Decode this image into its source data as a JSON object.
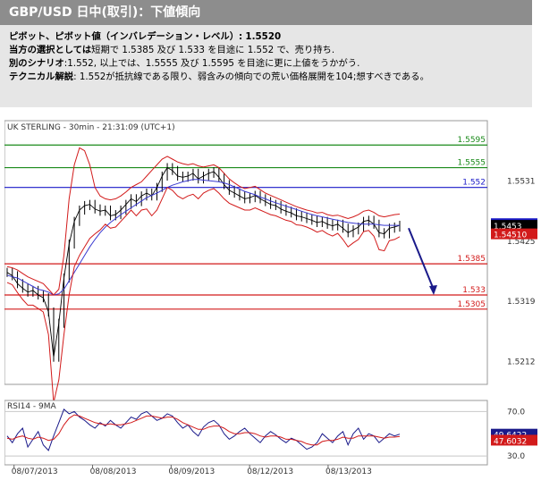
{
  "header": {
    "title": "GBP/USD 日中(取引)：下値傾向"
  },
  "analysis": {
    "pivot_label": "ピボット、ピボット値（インバレデーション・レベル）:",
    "pivot_value": "1.5520",
    "choice_label": "当方の選択としては",
    "choice_text": "短期で 1.5385 及び 1.533 を目途に 1.552 で、売り持ち.",
    "alt_label": "別のシナリオ",
    "alt_text": ":1.552, 以上では、1.5555 及び 1.5595 を目途に更に上値をうかがう.",
    "tech_label": "テクニカル解説",
    "tech_text": ": 1.552が抵抗線である限り、弱含みの傾向での荒い価格展開を104;想すべきである。"
  },
  "chart_data": [
    {
      "type": "line",
      "title": "UK STERLING - 30min - 21:31:09 (UTC+1)",
      "x_tick_labels": [
        "08/07/2013",
        "08/08/2013",
        "08/09/2013",
        "08/12/2013",
        "08/13/2013"
      ],
      "y_tick_labels": [
        "1.5531",
        "1.5425",
        "1.5319",
        "1.5212"
      ],
      "y_ticks": [
        1.5531,
        1.5425,
        1.5319,
        1.5212
      ],
      "ylim": [
        1.5172,
        1.5638
      ],
      "level_lines": [
        {
          "label": "1.5595",
          "value": 1.5595,
          "color": "#1a8a1a"
        },
        {
          "label": "1.5555",
          "value": 1.5555,
          "color": "#1a8a1a"
        },
        {
          "label": "1.552",
          "value": 1.552,
          "color": "#1a1ac8"
        },
        {
          "label": "1.5385",
          "value": 1.5385,
          "color": "#d21a1a"
        },
        {
          "label": "1.533",
          "value": 1.533,
          "color": "#d21a1a"
        },
        {
          "label": "1.5305",
          "value": 1.5305,
          "color": "#d21a1a"
        }
      ],
      "price_tags": [
        {
          "label": "1.54562",
          "value": 1.5456,
          "color": "#1a1ac8",
          "text_color": "#ffffff"
        },
        {
          "label": "1.5453",
          "value": 1.5453,
          "color": "#000000",
          "text_color": "#ffffff"
        },
        {
          "label": "1.54510",
          "value": 1.5438,
          "color": "#d21a1a",
          "text_color": "#ffffff"
        }
      ],
      "arrow": {
        "from": [
          1.5448
        ],
        "to": [
          1.533
        ],
        "color": "#1a1a8a"
      },
      "series": [
        {
          "color": "#000000",
          "values": [
            1.537,
            1.5364,
            1.535,
            1.5342,
            1.5335,
            1.5338,
            1.533,
            1.5325,
            1.53,
            1.522,
            1.528,
            1.536,
            1.542,
            1.546,
            1.548,
            1.5488,
            1.549,
            1.5482,
            1.5478,
            1.548,
            1.547,
            1.5472,
            1.548,
            1.549,
            1.55,
            1.5495,
            1.5505,
            1.551,
            1.5505,
            1.552,
            1.554,
            1.5555,
            1.555,
            1.554,
            1.5538,
            1.554,
            1.5545,
            1.5535,
            1.554,
            1.5545,
            1.5548,
            1.5538,
            1.5525,
            1.5515,
            1.551,
            1.5505,
            1.55,
            1.5502,
            1.5506,
            1.55,
            1.5495,
            1.549,
            1.5488,
            1.5482,
            1.5478,
            1.5475,
            1.547,
            1.5468,
            1.5465,
            1.5462,
            1.5458,
            1.546,
            1.5455,
            1.5452,
            1.5455,
            1.5448,
            1.544,
            1.5445,
            1.545,
            1.546,
            1.5462,
            1.5455,
            1.544,
            1.5438,
            1.5448,
            1.545,
            1.5453
          ]
        },
        {
          "color": "#3a3ad0",
          "values": [
            1.5365,
            1.5362,
            1.536,
            1.5355,
            1.535,
            1.5345,
            1.534,
            1.5338,
            1.5335,
            1.533,
            1.5332,
            1.534,
            1.5355,
            1.537,
            1.5385,
            1.54,
            1.5415,
            1.5428,
            1.544,
            1.545,
            1.5458,
            1.5465,
            1.5472,
            1.5478,
            1.5484,
            1.549,
            1.5496,
            1.5502,
            1.5506,
            1.551,
            1.5515,
            1.552,
            1.5524,
            1.5527,
            1.553,
            1.5532,
            1.5534,
            1.5534,
            1.5533,
            1.5532,
            1.5531,
            1.553,
            1.5528,
            1.5525,
            1.5521,
            1.5517,
            1.5513,
            1.551,
            1.5507,
            1.5503,
            1.55,
            1.5496,
            1.5493,
            1.549,
            1.5487,
            1.5484,
            1.5481,
            1.5478,
            1.5475,
            1.5472,
            1.547,
            1.5468,
            1.5466,
            1.5464,
            1.5462,
            1.546,
            1.5458,
            1.5457,
            1.5456,
            1.5455,
            1.5455,
            1.5455,
            1.5454,
            1.5453,
            1.5453,
            1.5453,
            1.5453
          ]
        },
        {
          "color": "#d21a1a",
          "values": [
            1.538,
            1.5378,
            1.5374,
            1.5368,
            1.5362,
            1.5358,
            1.5354,
            1.535,
            1.534,
            1.533,
            1.534,
            1.54,
            1.55,
            1.556,
            1.559,
            1.5585,
            1.556,
            1.552,
            1.5505,
            1.55,
            1.5498,
            1.55,
            1.5505,
            1.5512,
            1.552,
            1.5525,
            1.553,
            1.554,
            1.555,
            1.556,
            1.557,
            1.5575,
            1.557,
            1.5565,
            1.5562,
            1.556,
            1.5562,
            1.5558,
            1.5556,
            1.5558,
            1.556,
            1.5555,
            1.5545,
            1.5535,
            1.5528,
            1.5522,
            1.5518,
            1.552,
            1.5522,
            1.5516,
            1.551,
            1.5506,
            1.5502,
            1.5498,
            1.5494,
            1.549,
            1.5486,
            1.5483,
            1.548,
            1.5478,
            1.5475,
            1.5476,
            1.5472,
            1.547,
            1.5471,
            1.5468,
            1.5465,
            1.5468,
            1.5472,
            1.5478,
            1.548,
            1.5476,
            1.547,
            1.5468,
            1.547,
            1.5472,
            1.5473
          ]
        },
        {
          "color": "#d21a1a",
          "values": [
            1.5352,
            1.5348,
            1.5334,
            1.5322,
            1.5312,
            1.5312,
            1.5306,
            1.53,
            1.526,
            1.514,
            1.518,
            1.526,
            1.533,
            1.538,
            1.54,
            1.5415,
            1.543,
            1.5438,
            1.5445,
            1.5455,
            1.5448,
            1.545,
            1.546,
            1.547,
            1.548,
            1.547,
            1.548,
            1.5482,
            1.547,
            1.548,
            1.55,
            1.552,
            1.5515,
            1.5505,
            1.55,
            1.5505,
            1.5508,
            1.55,
            1.551,
            1.5515,
            1.5518,
            1.551,
            1.55,
            1.5492,
            1.5488,
            1.5484,
            1.548,
            1.548,
            1.5484,
            1.548,
            1.5476,
            1.5472,
            1.547,
            1.5466,
            1.5462,
            1.546,
            1.5454,
            1.5453,
            1.545,
            1.5446,
            1.5441,
            1.5444,
            1.5438,
            1.5434,
            1.5439,
            1.5428,
            1.5415,
            1.5422,
            1.5428,
            1.5442,
            1.5444,
            1.5434,
            1.541,
            1.5408,
            1.5426,
            1.5428,
            1.5433
          ]
        }
      ]
    },
    {
      "type": "line",
      "title": "RSI14 - 9MA",
      "y_tick_labels": [
        "70.0",
        "30.0"
      ],
      "y_ticks": [
        70,
        30
      ],
      "ylim": [
        22,
        80
      ],
      "price_tags": [
        {
          "label": "49.6422",
          "value": 49.6422,
          "color": "#1a1a8a",
          "text_color": "#ffffff"
        },
        {
          "label": "47.6032",
          "value": 44.2,
          "color": "#d21a1a",
          "text_color": "#ffffff"
        }
      ],
      "series": [
        {
          "color": "#1a1a8a",
          "values": [
            48,
            42,
            50,
            55,
            38,
            45,
            52,
            40,
            35,
            48,
            60,
            72,
            68,
            70,
            65,
            62,
            58,
            55,
            60,
            57,
            62,
            58,
            55,
            60,
            65,
            63,
            68,
            70,
            66,
            62,
            64,
            68,
            66,
            60,
            55,
            58,
            52,
            48,
            56,
            60,
            62,
            58,
            50,
            45,
            48,
            52,
            55,
            50,
            46,
            42,
            48,
            52,
            49,
            45,
            42,
            46,
            44,
            40,
            36,
            38,
            42,
            50,
            46,
            42,
            48,
            52,
            40,
            50,
            55,
            45,
            50,
            48,
            42,
            46,
            50,
            48,
            49.6
          ]
        },
        {
          "color": "#d21a1a",
          "values": [
            46,
            45,
            47,
            48,
            46,
            45,
            47,
            46,
            44,
            45,
            50,
            58,
            64,
            67,
            66,
            64,
            62,
            60,
            59,
            58,
            59,
            58,
            58,
            59,
            60,
            62,
            64,
            66,
            66,
            65,
            64,
            65,
            65,
            63,
            60,
            58,
            56,
            54,
            54,
            56,
            57,
            57,
            55,
            52,
            50,
            50,
            51,
            51,
            50,
            48,
            47,
            48,
            48,
            47,
            45,
            45,
            44,
            43,
            41,
            40,
            40,
            43,
            44,
            44,
            45,
            47,
            46,
            46,
            48,
            48,
            48,
            48,
            47,
            46,
            47,
            47,
            47.6
          ]
        }
      ]
    }
  ]
}
